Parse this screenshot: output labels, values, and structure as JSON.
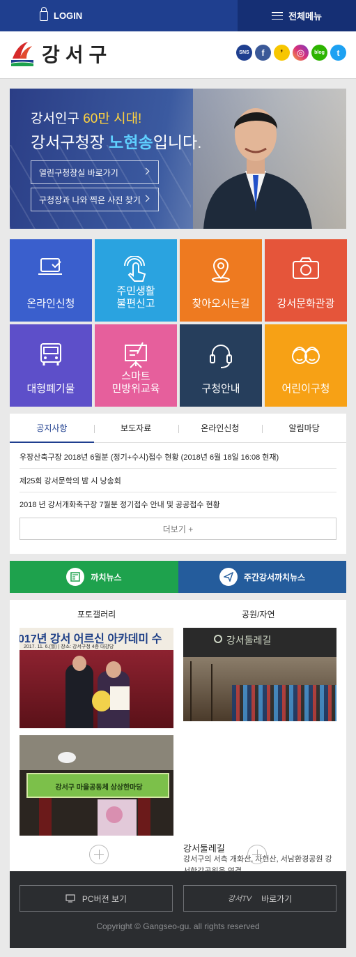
{
  "topbar": {
    "login_label": "LOGIN",
    "menu_label": "전체메뉴"
  },
  "header": {
    "logo_text": "강서구",
    "sns": [
      {
        "name": "강서구청 SNS",
        "label": "SNS",
        "color": "#1f3f8f"
      },
      {
        "name": "facebook",
        "label": "f",
        "color": "#3b5998"
      },
      {
        "name": "kakaostory",
        "label": "9",
        "color": "#f7c600"
      },
      {
        "name": "instagram",
        "label": "◎",
        "color": "#c13584"
      },
      {
        "name": "blog",
        "label": "blog",
        "color": "#2db400"
      },
      {
        "name": "twitter",
        "label": "t",
        "color": "#1da1f2"
      }
    ]
  },
  "banner": {
    "line1_prefix": "강서인구 ",
    "line1_highlight": "60만 시대!",
    "line2_prefix": "강서구청장 ",
    "line2_highlight": "노현송",
    "line2_suffix": "입니다.",
    "btn1": "열린구청장실 바로가기",
    "btn2": "구청장과 나와 찍은 사진 찾기"
  },
  "tiles": [
    {
      "label1": "온라인신청",
      "label2": "",
      "color": "#3a5fcd"
    },
    {
      "label1": "주민생활",
      "label2": "불편신고",
      "color": "#2aa3e0"
    },
    {
      "label1": "찾아오시는길",
      "label2": "",
      "color": "#ee7a20"
    },
    {
      "label1": "강서문화관광",
      "label2": "",
      "color": "#e5553a"
    },
    {
      "label1": "대형폐기물",
      "label2": "",
      "color": "#5d4fc9"
    },
    {
      "label1": "스마트",
      "label2": "민방위교육",
      "color": "#e65f9c"
    },
    {
      "label1": "구청안내",
      "label2": "",
      "color": "#263e5c"
    },
    {
      "label1": "어린이구청",
      "label2": "",
      "color": "#f7a115"
    }
  ],
  "news": {
    "tabs": [
      "공지사항",
      "보도자료",
      "온라인신청",
      "알림마당"
    ],
    "items": [
      "우장산축구장 2018년 6월분 (정기+수시)접수 현황 (2018년 6월 18일 16:08 현재)",
      "제25회 강서문학의 밤 시 낭송회",
      "2018 년 강서개화축구장 7월분 정기접수 안내 및 공공접수 현황"
    ],
    "more_label": "더보기 +"
  },
  "links": {
    "kkachi": "까치뉴스",
    "weekly": "주간강서까치뉴스"
  },
  "gallery": {
    "photo_title": "포토갤러리",
    "park_title": "공원/자연",
    "photo1_banner": "017년 강서 어르신 아카데미 수",
    "photo1_sub": "2017. 11. 6.(월) | 장소: 강서구청 4층 대강당",
    "photo2_banner": "강서구 마을공동체 상상한마당",
    "park_photo_sign": "강서둘레길",
    "park_name": "강서둘레길",
    "park_desc": "강서구의 서측 개화산, 차현산, 서남환경공원 강서한강공원을 연결"
  },
  "footer": {
    "pc_label": "PC버전 보기",
    "tv_logo": "강서TV",
    "tv_label": "바로가기",
    "copyright": "Copyright © Gangseo-gu. all rights reserved"
  }
}
